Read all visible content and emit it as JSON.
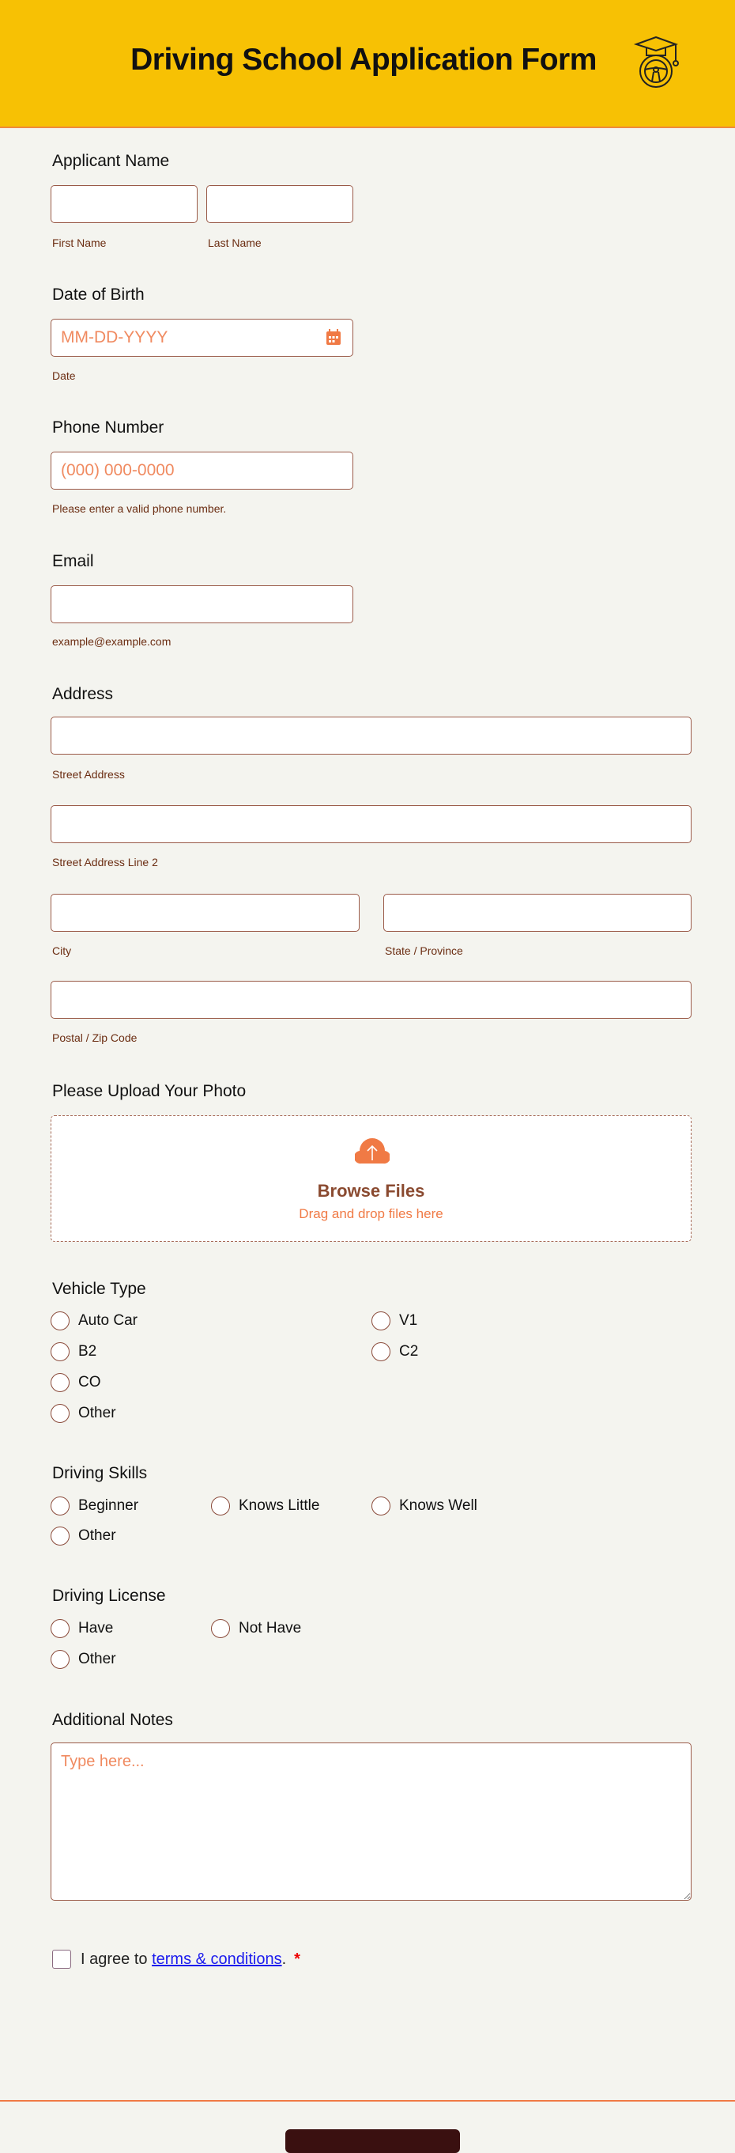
{
  "header": {
    "title": "Driving School Application Form",
    "logo_icon": "graduation-cap-steering-wheel-icon"
  },
  "applicant_name": {
    "label": "Applicant Name",
    "first_sublabel": "First Name",
    "last_sublabel": "Last Name"
  },
  "dob": {
    "label": "Date of Birth",
    "placeholder": "MM-DD-YYYY",
    "sublabel": "Date"
  },
  "phone": {
    "label": "Phone Number",
    "placeholder": "(000) 000-0000",
    "sublabel": "Please enter a valid phone number."
  },
  "email": {
    "label": "Email",
    "sublabel": "example@example.com"
  },
  "address": {
    "label": "Address",
    "street": "Street Address",
    "street2": "Street Address Line 2",
    "city": "City",
    "state": "State / Province",
    "postal": "Postal / Zip Code"
  },
  "upload": {
    "label": "Please Upload Your Photo",
    "browse": "Browse Files",
    "drag": "Drag and drop files here"
  },
  "vehicle": {
    "label": "Vehicle Type",
    "options": [
      "Auto Car",
      "V1",
      "B2",
      "C2",
      "CO",
      "Other"
    ]
  },
  "skills": {
    "label": "Driving Skills",
    "options": [
      "Beginner",
      "Knows Little",
      "Knows Well",
      "Other"
    ]
  },
  "license": {
    "label": "Driving License",
    "options": [
      "Have",
      "Not Have",
      "Other"
    ]
  },
  "notes": {
    "label": "Additional Notes",
    "placeholder": "Type here..."
  },
  "terms": {
    "prefix": "I agree to ",
    "link": "terms & conditions",
    "suffix": ".",
    "required": "*"
  },
  "colors": {
    "header": "#f7c104",
    "accent": "#f07a45",
    "border": "#9a5a48"
  }
}
